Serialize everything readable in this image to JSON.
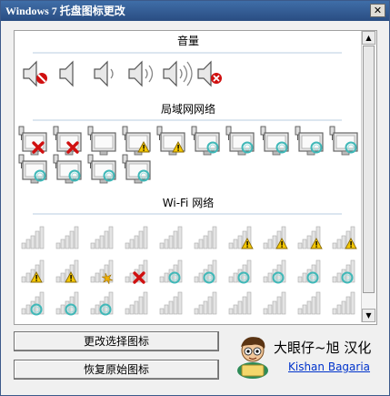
{
  "window": {
    "title": "Windows 7 托盘图标更改",
    "close_glyph": "✕"
  },
  "sections": {
    "volume": {
      "title": "音量"
    },
    "lan": {
      "title": "局域网网络"
    },
    "wifi": {
      "title": "Wi-Fi 网络"
    }
  },
  "scrollbar": {
    "up_glyph": "▲",
    "down_glyph": "▼"
  },
  "buttons": {
    "change": "更改选择图标",
    "restore": "恢复原始图标"
  },
  "credit": {
    "text": "大眼仔~旭 汉化",
    "link": "Kishan Bagaria"
  },
  "colors": {
    "title_bar": "#2a4d82",
    "link": "#0033cc",
    "error_red": "#d01010",
    "warning_yellow": "#f5c800",
    "wifi_teal": "#3fb8b8"
  }
}
